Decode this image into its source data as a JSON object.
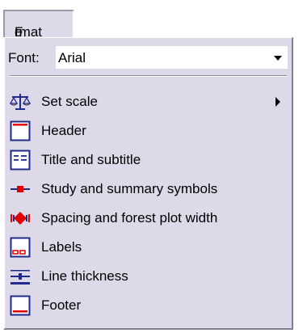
{
  "menu": {
    "title_first": "F",
    "title_underlined": "o",
    "title_rest": "rmat"
  },
  "font": {
    "label": "Font:",
    "value": "Arial"
  },
  "items": [
    {
      "label": "Set scale",
      "icon": "balance-scale-icon",
      "submenu": true
    },
    {
      "label": "Header",
      "icon": "header-icon"
    },
    {
      "label": "Title and subtitle",
      "icon": "title-subtitle-icon"
    },
    {
      "label": "Study and summary symbols",
      "icon": "study-symbols-icon"
    },
    {
      "label": "Spacing and forest plot width",
      "icon": "spacing-width-icon"
    },
    {
      "label": "Labels",
      "icon": "labels-icon"
    },
    {
      "label": "Line thickness",
      "icon": "line-thickness-icon"
    },
    {
      "label": "Footer",
      "icon": "footer-icon"
    }
  ],
  "colors": {
    "menu_bg": "#ddd9e8",
    "icon_blue": "#1f2b8f",
    "icon_red": "#e00000"
  }
}
